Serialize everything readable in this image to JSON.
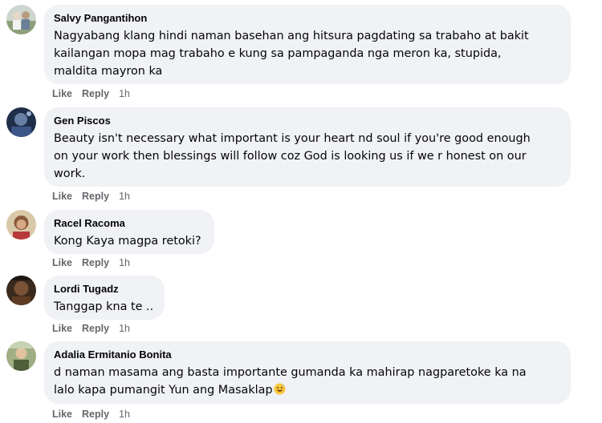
{
  "actions": {
    "like_label": "Like",
    "reply_label": "Reply"
  },
  "comments": [
    {
      "author": "Salvy Pangantihon",
      "text": "Nagyabang klang hindi naman basehan ang hitsura pagdating sa trabaho at bakit\nkailangan mopa mag trabaho e kung sa pampaganda nga meron ka, stupida,\nmaldita mayron ka",
      "time": "1h"
    },
    {
      "author": "Gen Piscos",
      "text": "Beauty isn't necessary what important is your heart nd soul if you're good enough\non your work then blessings will follow coz God is looking us if we r honest on our\nwork.",
      "time": "1h"
    },
    {
      "author": "Racel Racoma",
      "text": "Kong Kaya magpa retoki?",
      "time": "1h"
    },
    {
      "author": "Lordi Tugadz",
      "text": "Tanggap kna te ..",
      "time": "1h"
    },
    {
      "author": "Adalia Ermitanio Bonita",
      "text": "d naman masama ang basta importante gumanda ka mahirap nagparetoke ka na\nlalo kapa pumangit Yun ang Masaklap",
      "emoji": "grinning-sweat-emoji",
      "time": "1h"
    }
  ]
}
